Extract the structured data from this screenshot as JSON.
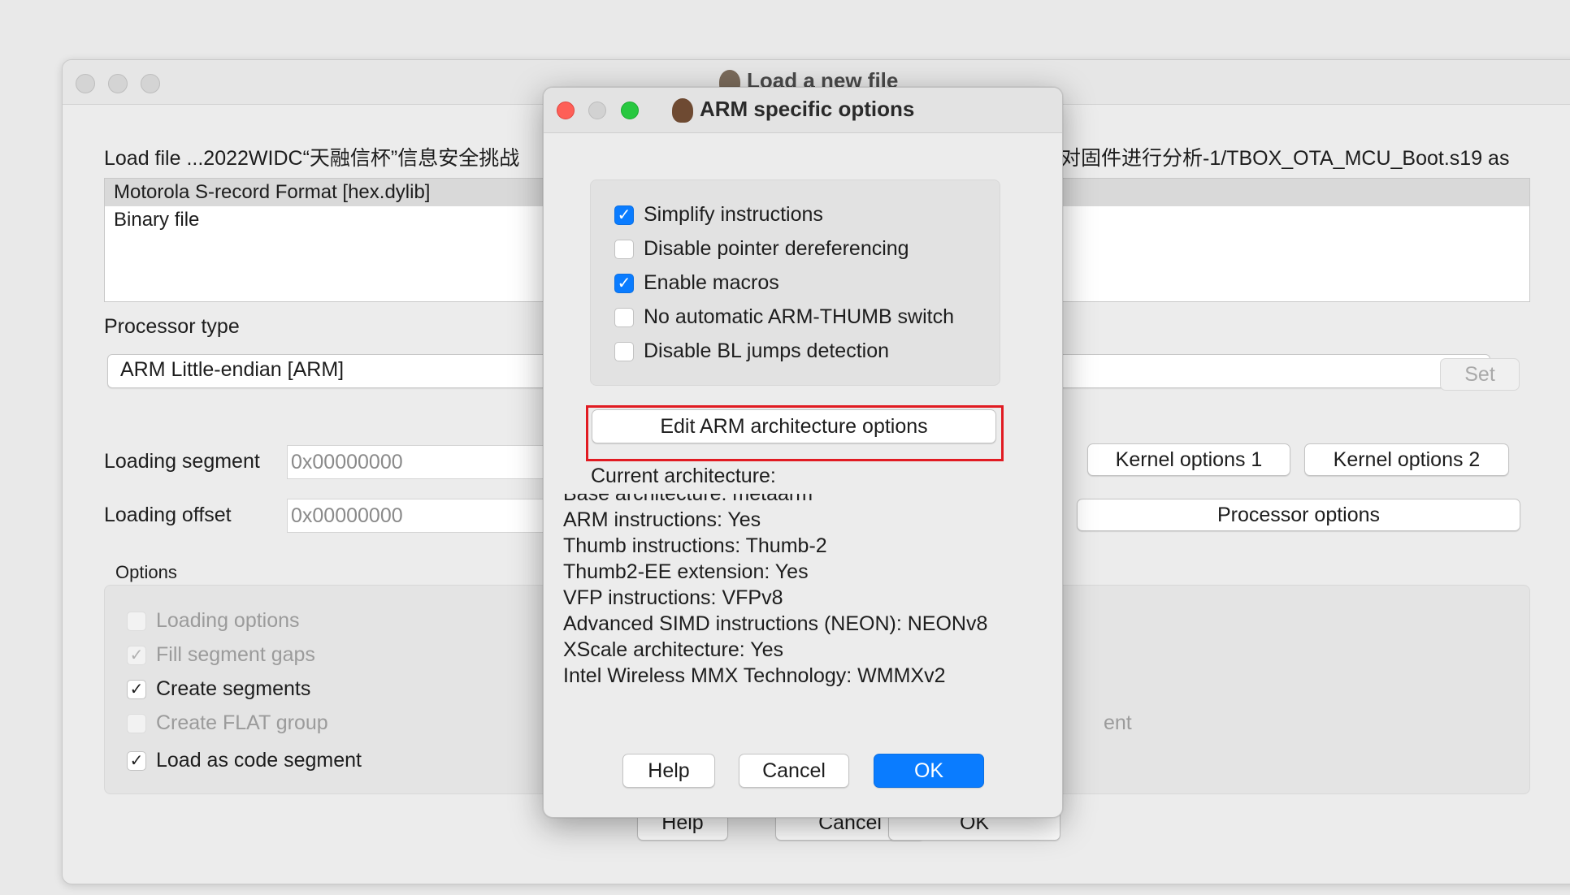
{
  "main_window": {
    "title": "Load a new file",
    "load_file_label": "Load file ...2022WIDC“天融信杯”信息安全挑战",
    "load_file_label_tail": "对固件进行分析-1/TBOX_OTA_MCU_Boot.s19 as",
    "file_formats": [
      {
        "label": "Motorola S-record Format [hex.dylib]",
        "selected": true
      },
      {
        "label": "Binary file",
        "selected": false
      }
    ],
    "processor_type_label": "Processor type",
    "processor_value": "ARM Little-endian [ARM]",
    "set_button": "Set",
    "loading_segment_label": "Loading segment",
    "loading_segment_value": "0x00000000",
    "loading_offset_label": "Loading offset",
    "loading_offset_value": "0x00000000",
    "kernel_options_1": "Kernel options 1",
    "kernel_options_2": "Kernel options 2",
    "processor_options": "Processor options",
    "options_label": "Options",
    "options": [
      {
        "label": "Loading options",
        "checked": false,
        "enabled": false
      },
      {
        "label": "Fill segment gaps",
        "checked": true,
        "enabled": false
      },
      {
        "label": "Create segments",
        "checked": true,
        "enabled": true
      },
      {
        "label": "Create FLAT group",
        "checked": false,
        "enabled": false
      },
      {
        "label": "Load as code segment",
        "checked": true,
        "enabled": true
      }
    ],
    "partial_option_tail": "ent",
    "help_button": "Help",
    "cancel_button": "Cancel",
    "ok_button": "OK"
  },
  "arm_dialog": {
    "title": "ARM specific options",
    "checkboxes": [
      {
        "label": "Simplify instructions",
        "checked": true
      },
      {
        "label": "Disable pointer dereferencing",
        "checked": false
      },
      {
        "label": "Enable macros",
        "checked": true
      },
      {
        "label": "No automatic ARM-THUMB switch",
        "checked": false
      },
      {
        "label": "Disable BL jumps detection",
        "checked": false
      }
    ],
    "edit_arch_button": "Edit ARM architecture options",
    "current_arch_label": "Current architecture:",
    "arch_lines": [
      "Base architecture: metaarm",
      "ARM instructions: Yes",
      "Thumb instructions: Thumb-2",
      "Thumb2-EE extension: Yes",
      "VFP instructions: VFPv8",
      "Advanced SIMD instructions (NEON): NEONv8",
      "XScale architecture: Yes",
      "Intel Wireless MMX Technology: WMMXv2"
    ],
    "help_button": "Help",
    "cancel_button": "Cancel",
    "ok_button": "OK"
  },
  "colors": {
    "accent": "#0a7cff",
    "highlight": "#e11b22",
    "close": "#fe5f57",
    "zoom": "#28c840"
  }
}
